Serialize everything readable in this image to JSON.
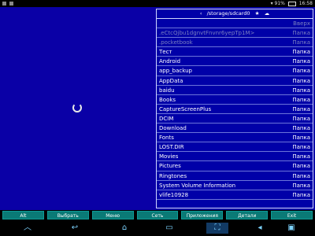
{
  "statusbar": {
    "right_text": "91% 16:58",
    "battery": "91%",
    "time": "16:58"
  },
  "panel": {
    "path": "/storage/sdcard0",
    "rows": [
      {
        "name": "",
        "type": "Вверх",
        "dim": true
      },
      {
        "name": ".eCtcQjbu1dgnvtFnvnr6yepTp1M>",
        "type": "Папка",
        "dim": true
      },
      {
        "name": ".pocketbook",
        "type": "Папка",
        "dim": true
      },
      {
        "name": "Тест",
        "type": "Папка"
      },
      {
        "name": "Android",
        "type": "Папка"
      },
      {
        "name": "app_backup",
        "type": "Папка"
      },
      {
        "name": "AppData",
        "type": "Папка"
      },
      {
        "name": "baidu",
        "type": "Папка"
      },
      {
        "name": "Books",
        "type": "Папка"
      },
      {
        "name": "CaptureScreenPlus",
        "type": "Папка"
      },
      {
        "name": "DCIM",
        "type": "Папка"
      },
      {
        "name": "Download",
        "type": "Папка"
      },
      {
        "name": "Fonts",
        "type": "Папка"
      },
      {
        "name": "LOST.DIR",
        "type": "Папка"
      },
      {
        "name": "Movies",
        "type": "Папка"
      },
      {
        "name": "Pictures",
        "type": "Папка"
      },
      {
        "name": "Ringtones",
        "type": "Папка"
      },
      {
        "name": "System Volume Information",
        "type": "Папка"
      },
      {
        "name": "vlife10928",
        "type": "Папка"
      }
    ]
  },
  "toolbar": {
    "buttons": [
      "Alt",
      "Выбрать",
      "Меню",
      "Сеть",
      "Приложения",
      "Детали",
      "Exit"
    ]
  }
}
